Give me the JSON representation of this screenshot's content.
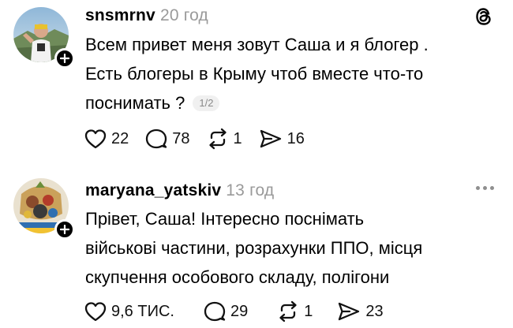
{
  "posts": [
    {
      "username": "snsmrnv",
      "time": "20 год",
      "lines": [
        "Всем привет меня зовут Саша и я блогер .",
        "Есть блогеры в Крыму чтоб вместе что-то",
        "поснимать ?"
      ],
      "page_badge": "1/2",
      "likes": "22",
      "comments": "78",
      "reposts": "1",
      "shares": "16"
    },
    {
      "username": "maryana_yatskiv",
      "time": "13 год",
      "lines": [
        "Прівет, Саша! Інтересно поснімать",
        "військові частини, розрахунки ППО, місця",
        "скупчення особового складу, полігони"
      ],
      "likes": "9,6 ТИС.",
      "comments": "29",
      "reposts": "1",
      "shares": "23"
    }
  ],
  "icons": {
    "brand": "threads-logo-icon",
    "follow": "plus-icon",
    "like": "heart-icon",
    "comment": "comment-bubble-icon",
    "repost": "repost-icon",
    "share": "send-icon",
    "more": "more-dots-icon"
  }
}
